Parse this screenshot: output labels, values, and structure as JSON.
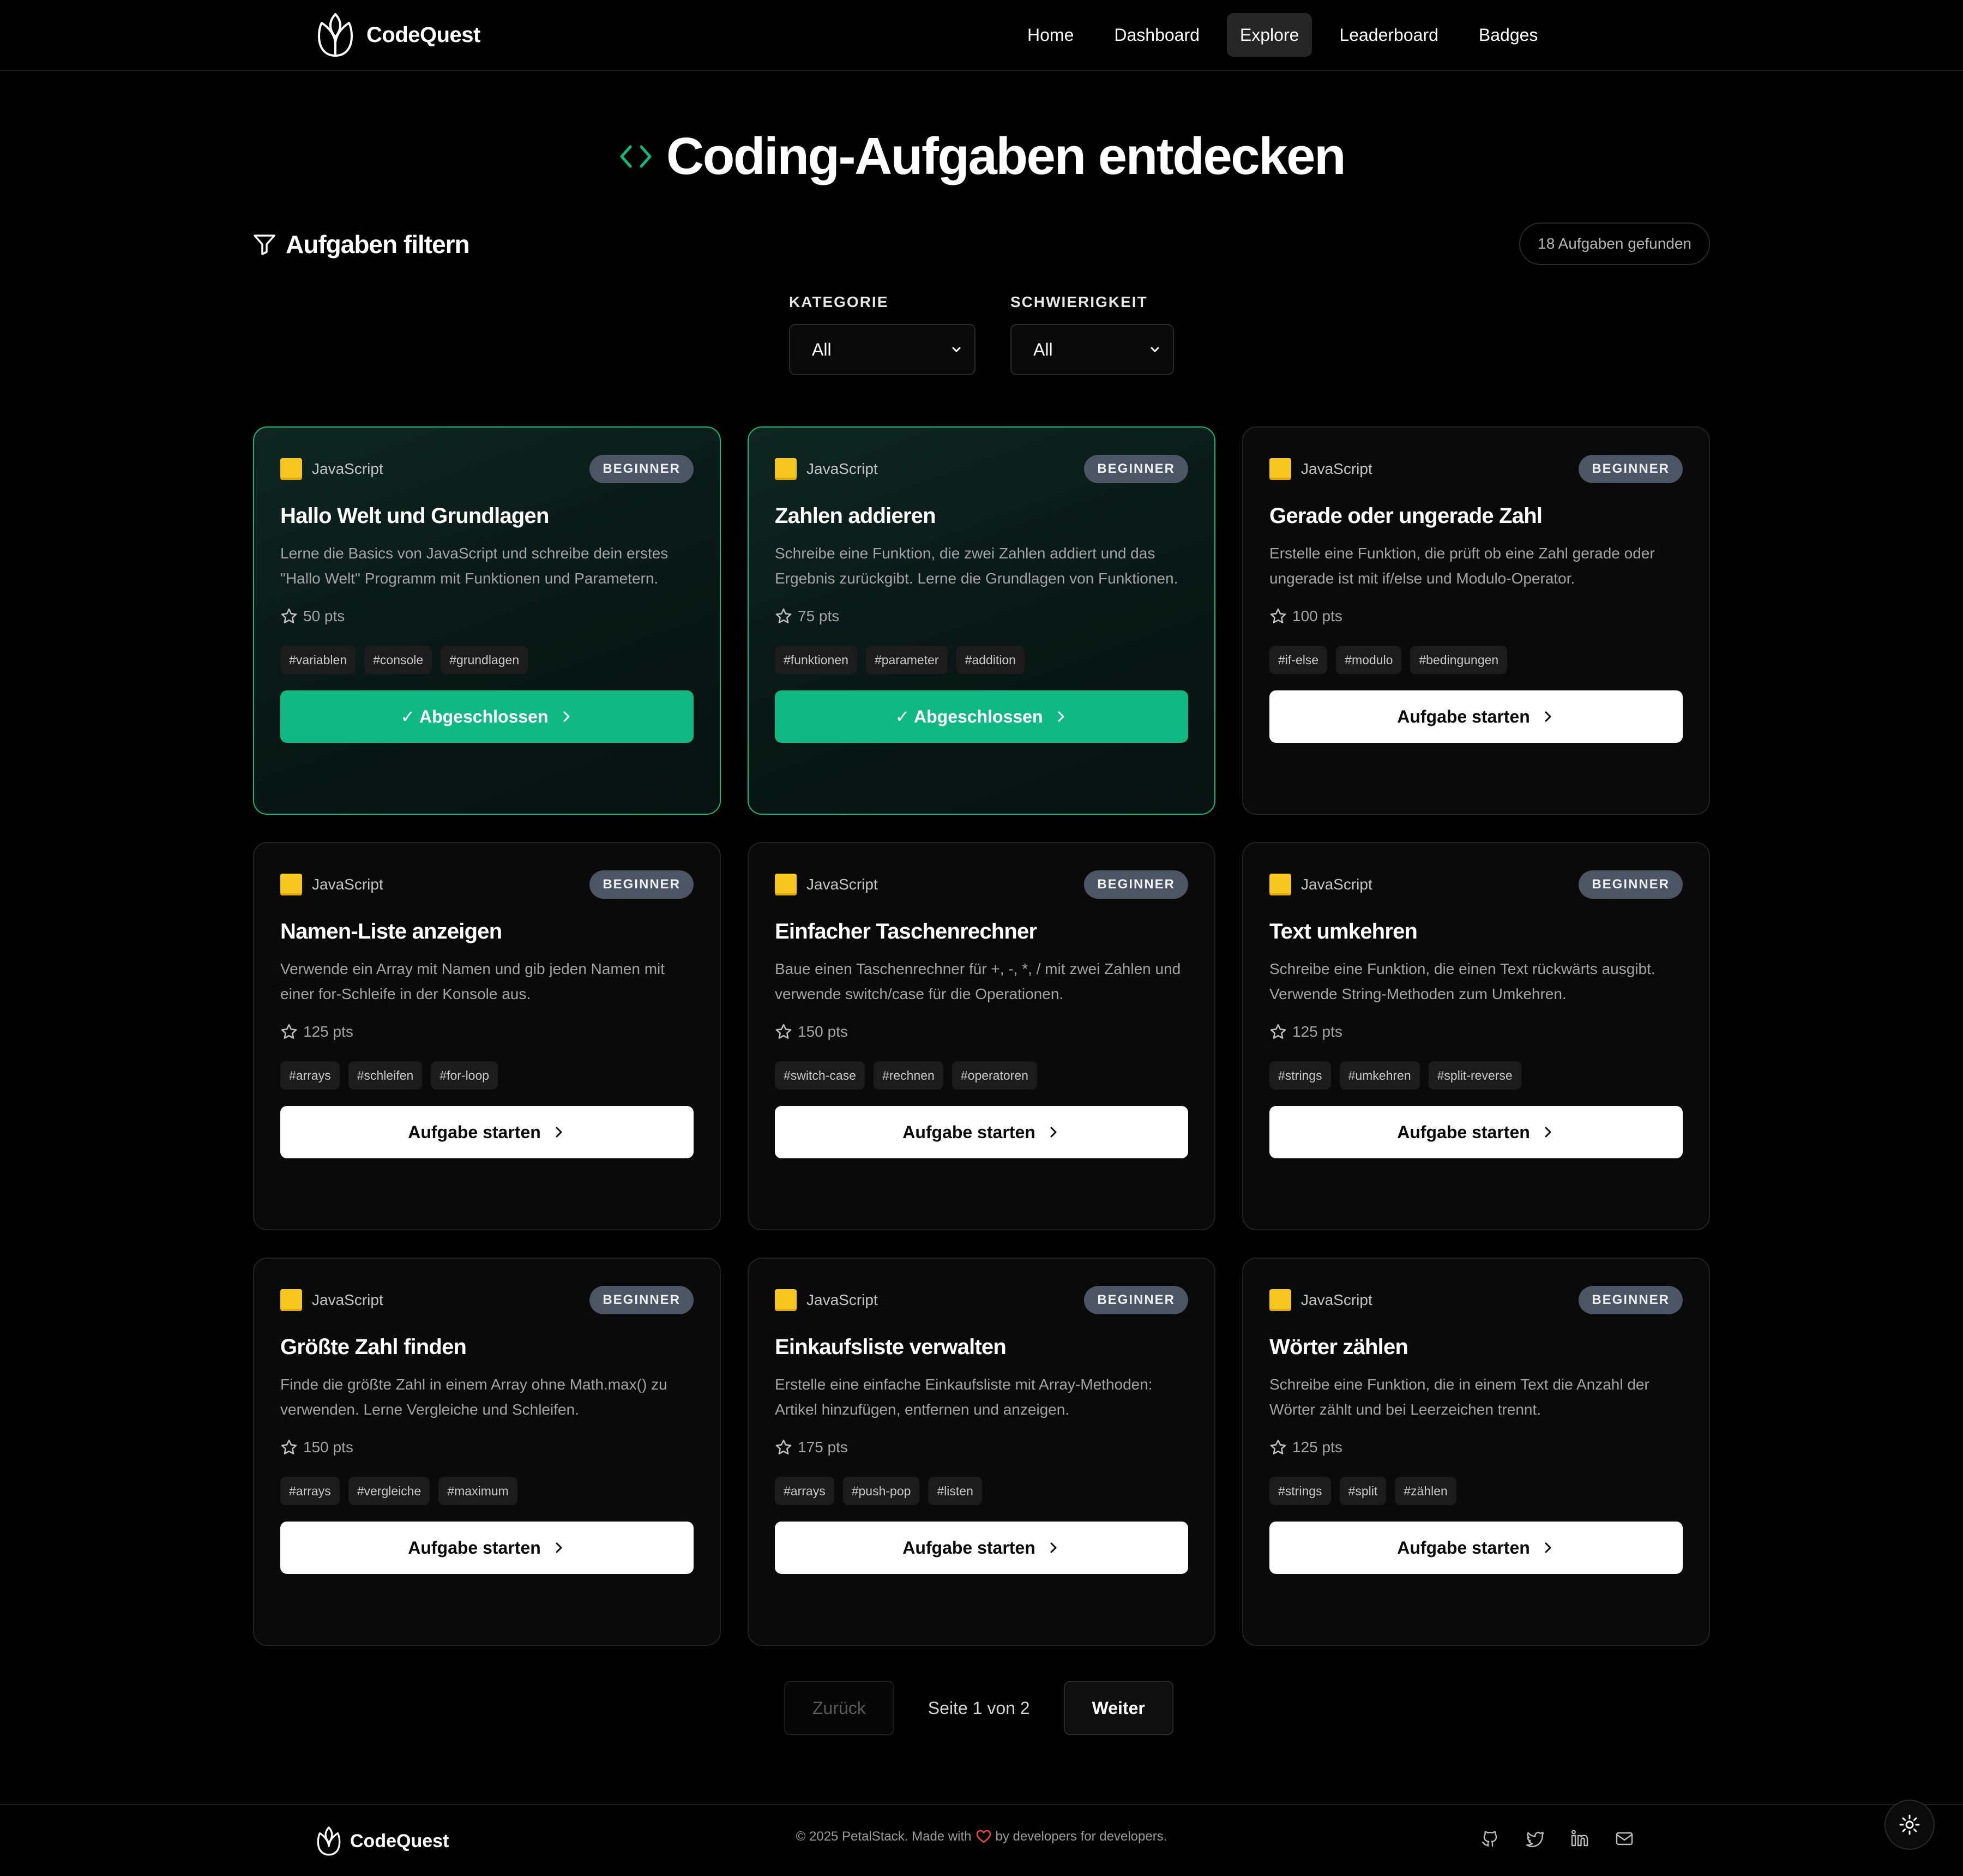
{
  "nav": {
    "brand": "CodeQuest",
    "links": [
      "Home",
      "Dashboard",
      "Explore",
      "Leaderboard",
      "Badges"
    ],
    "active": "Explore"
  },
  "header": {
    "title": "Coding-Aufgaben entdecken"
  },
  "filters": {
    "title": "Aufgaben filtern",
    "found": "18 Aufgaben gefunden",
    "category_label": "KATEGORIE",
    "category_value": "All",
    "difficulty_label": "SCHWIERIGKEIT",
    "difficulty_value": "All"
  },
  "colors": {
    "accent": "#10b981",
    "language_swatch": "#f7c61f",
    "badge": "#4b5563"
  },
  "cards": [
    {
      "language": "JavaScript",
      "level": "BEGINNER",
      "title": "Hallo Welt und Grundlagen",
      "description": "Lerne die Basics von JavaScript und schreibe dein erstes \"Hallo Welt\" Programm mit Funktionen und Parametern.",
      "points": "50 pts",
      "tags": [
        "#variablen",
        "#console",
        "#grundlagen"
      ],
      "button": "✓ Abgeschlossen",
      "completed": true
    },
    {
      "language": "JavaScript",
      "level": "BEGINNER",
      "title": "Zahlen addieren",
      "description": "Schreibe eine Funktion, die zwei Zahlen addiert und das Ergebnis zurückgibt. Lerne die Grundlagen von Funktionen.",
      "points": "75 pts",
      "tags": [
        "#funktionen",
        "#parameter",
        "#addition"
      ],
      "button": "✓ Abgeschlossen",
      "completed": true
    },
    {
      "language": "JavaScript",
      "level": "BEGINNER",
      "title": "Gerade oder ungerade Zahl",
      "description": "Erstelle eine Funktion, die prüft ob eine Zahl gerade oder ungerade ist mit if/else und Modulo-Operator.",
      "points": "100 pts",
      "tags": [
        "#if-else",
        "#modulo",
        "#bedingungen"
      ],
      "button": "Aufgabe starten",
      "completed": false
    },
    {
      "language": "JavaScript",
      "level": "BEGINNER",
      "title": "Namen-Liste anzeigen",
      "description": "Verwende ein Array mit Namen und gib jeden Namen mit einer for-Schleife in der Konsole aus.",
      "points": "125 pts",
      "tags": [
        "#arrays",
        "#schleifen",
        "#for-loop"
      ],
      "button": "Aufgabe starten",
      "completed": false
    },
    {
      "language": "JavaScript",
      "level": "BEGINNER",
      "title": "Einfacher Taschenrechner",
      "description": "Baue einen Taschenrechner für +, -, *, / mit zwei Zahlen und verwende switch/case für die Operationen.",
      "points": "150 pts",
      "tags": [
        "#switch-case",
        "#rechnen",
        "#operatoren"
      ],
      "button": "Aufgabe starten",
      "completed": false
    },
    {
      "language": "JavaScript",
      "level": "BEGINNER",
      "title": "Text umkehren",
      "description": "Schreibe eine Funktion, die einen Text rückwärts ausgibt. Verwende String-Methoden zum Umkehren.",
      "points": "125 pts",
      "tags": [
        "#strings",
        "#umkehren",
        "#split-reverse"
      ],
      "button": "Aufgabe starten",
      "completed": false
    },
    {
      "language": "JavaScript",
      "level": "BEGINNER",
      "title": "Größte Zahl finden",
      "description": "Finde die größte Zahl in einem Array ohne Math.max() zu verwenden. Lerne Vergleiche und Schleifen.",
      "points": "150 pts",
      "tags": [
        "#arrays",
        "#vergleiche",
        "#maximum"
      ],
      "button": "Aufgabe starten",
      "completed": false
    },
    {
      "language": "JavaScript",
      "level": "BEGINNER",
      "title": "Einkaufsliste verwalten",
      "description": "Erstelle eine einfache Einkaufsliste mit Array-Methoden: Artikel hinzufügen, entfernen und anzeigen.",
      "points": "175 pts",
      "tags": [
        "#arrays",
        "#push-pop",
        "#listen"
      ],
      "button": "Aufgabe starten",
      "completed": false
    },
    {
      "language": "JavaScript",
      "level": "BEGINNER",
      "title": "Wörter zählen",
      "description": "Schreibe eine Funktion, die in einem Text die Anzahl der Wörter zählt und bei Leerzeichen trennt.",
      "points": "125 pts",
      "tags": [
        "#strings",
        "#split",
        "#zählen"
      ],
      "button": "Aufgabe starten",
      "completed": false
    }
  ],
  "pagination": {
    "prev": "Zurück",
    "info": "Seite 1 von 2",
    "next": "Weiter"
  },
  "footer": {
    "brand": "CodeQuest",
    "copyright_pre": "© 2025 PetalStack. Made with",
    "copyright_post": "by developers for developers.",
    "socials": [
      "github-icon",
      "twitter-icon",
      "linkedin-icon",
      "mail-icon"
    ]
  }
}
